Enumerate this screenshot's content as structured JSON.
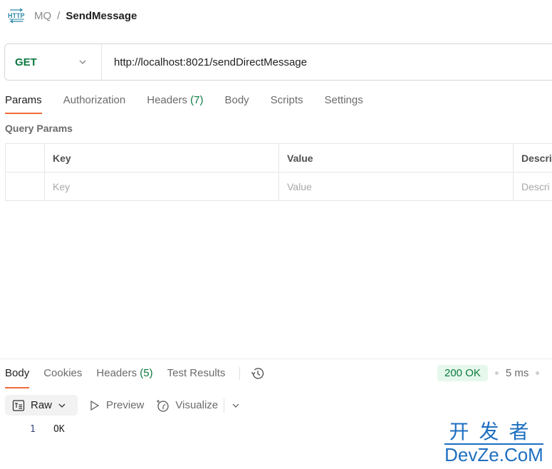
{
  "breadcrumb": {
    "icon": "http-icon",
    "parent": "MQ",
    "separator": "/",
    "current": "SendMessage"
  },
  "request": {
    "method": "GET",
    "url": "http://localhost:8021/sendDirectMessage"
  },
  "request_tabs": [
    {
      "label": "Params",
      "active": true
    },
    {
      "label": "Authorization"
    },
    {
      "label": "Headers",
      "count": "(7)"
    },
    {
      "label": "Body"
    },
    {
      "label": "Scripts"
    },
    {
      "label": "Settings"
    }
  ],
  "query_params": {
    "title": "Query Params",
    "columns": [
      "Key",
      "Value",
      "Descri"
    ],
    "placeholders": [
      "Key",
      "Value",
      "Descri"
    ]
  },
  "response_tabs": [
    {
      "label": "Body",
      "active": true
    },
    {
      "label": "Cookies"
    },
    {
      "label": "Headers",
      "count": "(5)"
    },
    {
      "label": "Test Results"
    }
  ],
  "response_status": {
    "code": "200 OK",
    "time": "5 ms",
    "status_color": "#0b7a3e"
  },
  "response_toolbar": {
    "format": "Raw",
    "preview": "Preview",
    "visualize": "Visualize"
  },
  "response_body": {
    "lines": [
      {
        "no": "1",
        "text": "OK"
      }
    ]
  },
  "watermark": {
    "cn": "开发者",
    "en": "DevZe.CoM"
  },
  "colors": {
    "accent": "#f26b3a",
    "method_get": "#0b7a3e"
  }
}
